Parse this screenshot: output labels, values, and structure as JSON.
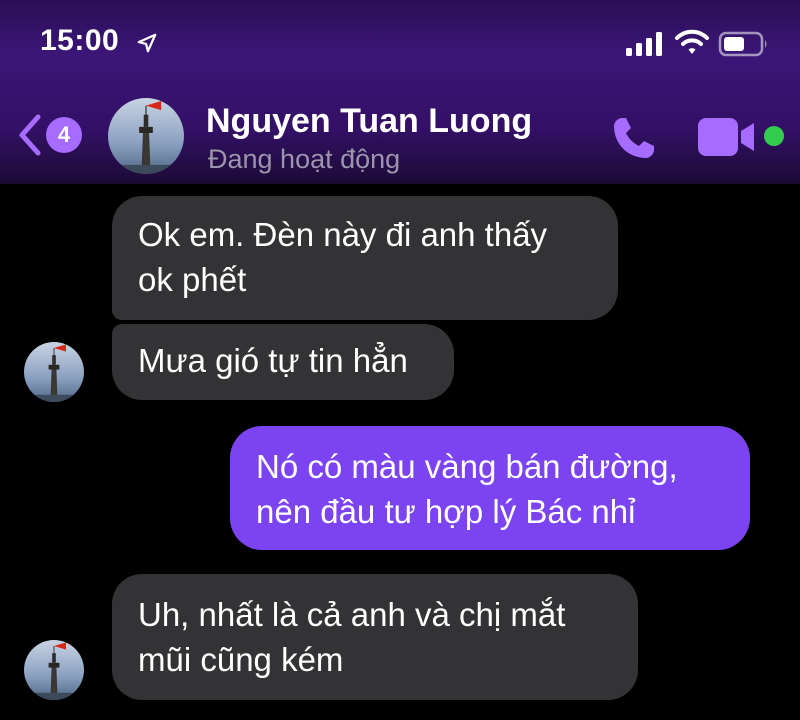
{
  "status_bar": {
    "time": "15:00",
    "icons": [
      "location-arrow-icon",
      "signal-icon",
      "wifi-icon",
      "battery-icon"
    ]
  },
  "header": {
    "back_badge_count": "4",
    "contact_name": "Nguyen Tuan Luong",
    "contact_status": "Đang hoạt động",
    "icons": [
      "back-chevron-icon",
      "phone-icon",
      "video-camera-icon",
      "online-dot"
    ]
  },
  "colors": {
    "accent": "#a66bff",
    "outgoing_bubble": "#7b44f0",
    "incoming_bubble": "#333336",
    "online_dot": "#33cc4e",
    "header_gradient": "#3b1677"
  },
  "messages": [
    {
      "direction": "incoming",
      "lines": [
        "Ok em. Đèn này đi anh thấy",
        "ok phết"
      ]
    },
    {
      "direction": "incoming",
      "lines": [
        "Mưa gió tự tin hẳn"
      ]
    },
    {
      "direction": "outgoing",
      "lines": [
        "Nó có màu vàng bán đường,",
        "nên đầu tư hợp lý Bác nhỉ"
      ]
    },
    {
      "direction": "incoming",
      "lines": [
        "Uh, nhất là cả anh và chị mắt",
        "mũi cũng kém"
      ]
    }
  ]
}
